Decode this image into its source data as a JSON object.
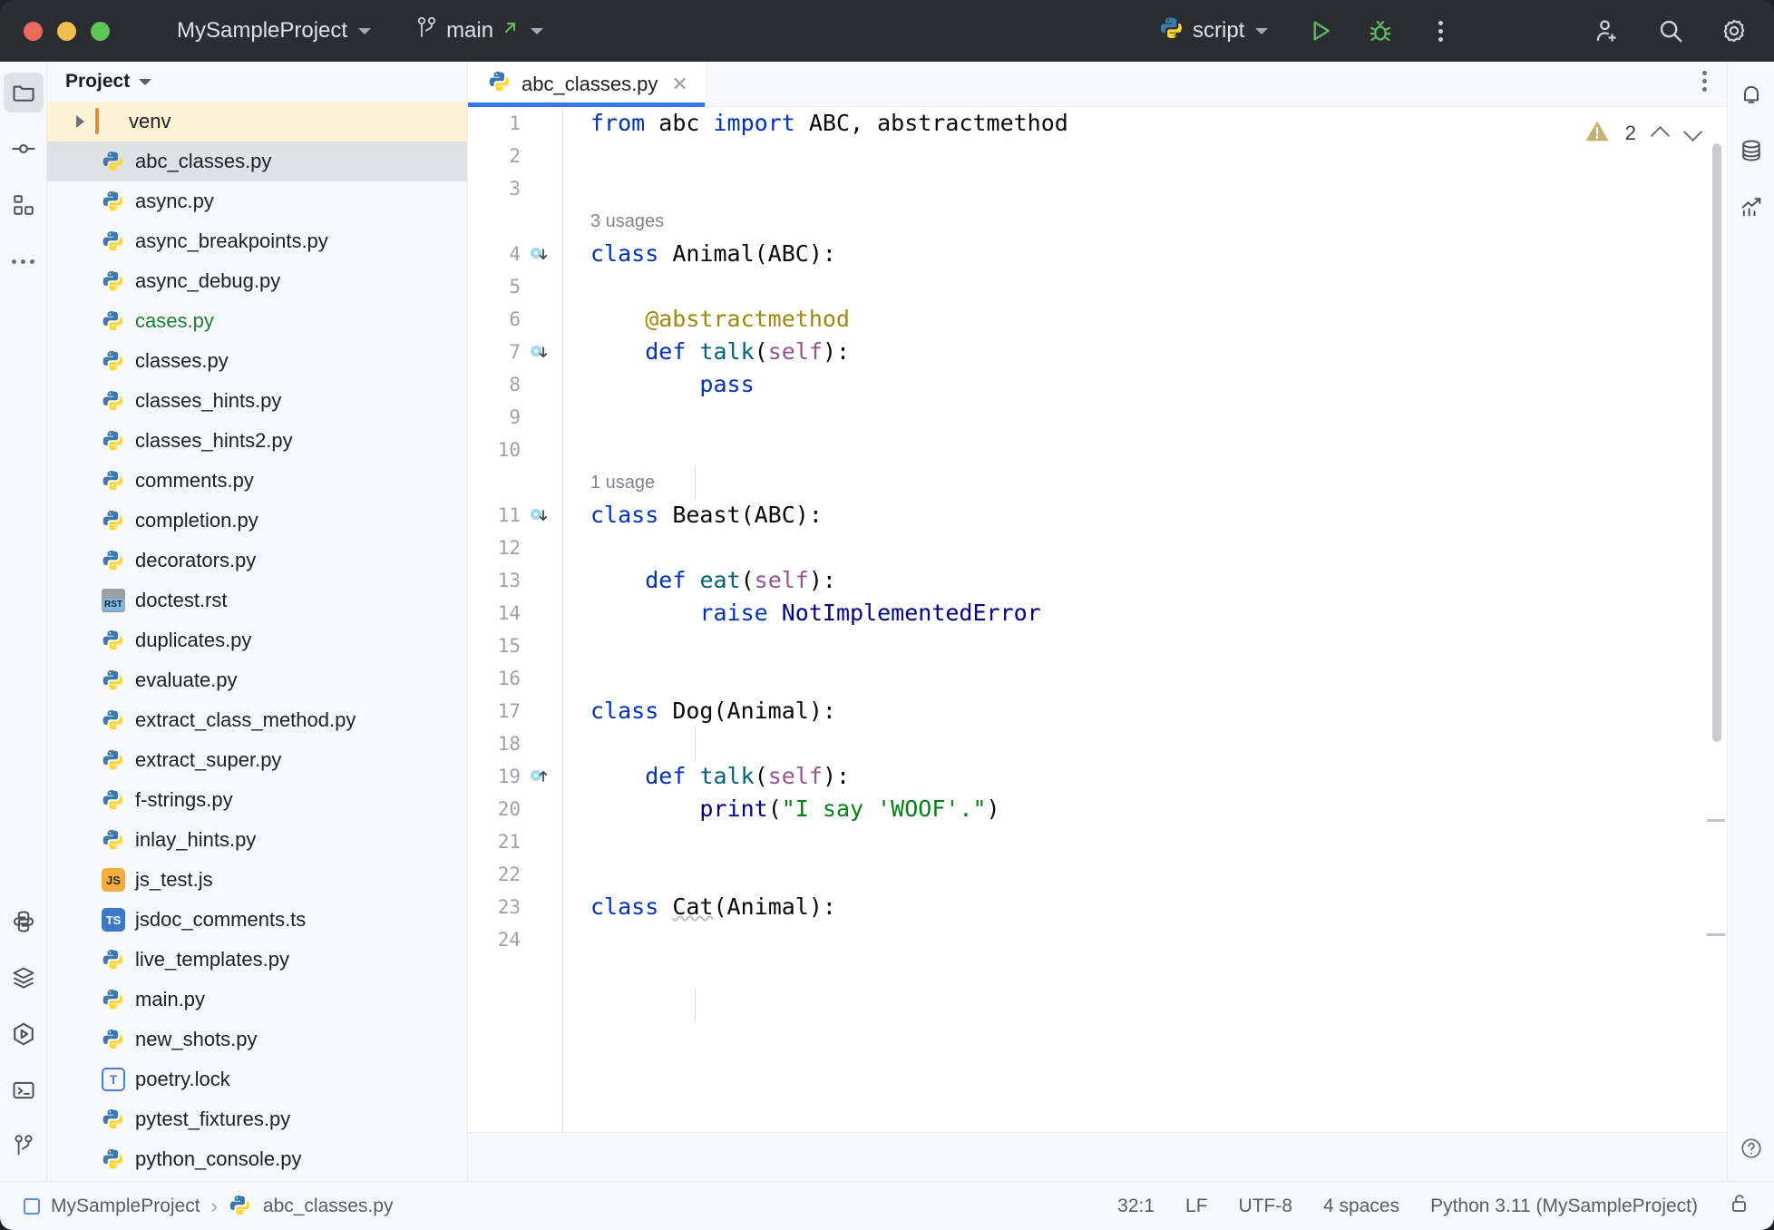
{
  "titlebar": {
    "project_name": "MySampleProject",
    "branch_name": "main",
    "run_config": "script",
    "icons": {
      "branch": "git-branch-icon",
      "branch_external": "external-link-icon",
      "python_config": "python-icon",
      "run": "run-icon",
      "debug": "debug-icon",
      "more": "more-options-icon",
      "share": "add-user-icon",
      "search": "search-icon",
      "settings": "gear-icon"
    }
  },
  "left_rail": {
    "items": [
      {
        "name": "project-tool-window",
        "icon": "folder-icon",
        "active": true
      },
      {
        "name": "commit-tool-window",
        "icon": "commit-icon",
        "active": false
      },
      {
        "name": "structure-tool-window",
        "icon": "structure-icon",
        "active": false
      },
      {
        "name": "more-tool-windows",
        "icon": "ellipsis-icon",
        "active": false
      }
    ],
    "bottom_items": [
      {
        "name": "python-console-tool-window",
        "icon": "python-console-icon"
      },
      {
        "name": "python-packages-tool-window",
        "icon": "layers-icon"
      },
      {
        "name": "run-tool-window",
        "icon": "run-hexagon-icon"
      },
      {
        "name": "terminal-tool-window",
        "icon": "terminal-icon"
      },
      {
        "name": "version-control-tool-window",
        "icon": "git-branch-icon"
      }
    ]
  },
  "project_panel": {
    "title": "Project",
    "files": [
      {
        "name": "venv",
        "type": "folder",
        "state": "highlighted",
        "expandable": true
      },
      {
        "name": "abc_classes.py",
        "type": "py",
        "state": "selected"
      },
      {
        "name": "async.py",
        "type": "py",
        "state": "normal"
      },
      {
        "name": "async_breakpoints.py",
        "type": "py",
        "state": "normal"
      },
      {
        "name": "async_debug.py",
        "type": "py",
        "state": "normal"
      },
      {
        "name": "cases.py",
        "type": "py",
        "state": "green"
      },
      {
        "name": "classes.py",
        "type": "py",
        "state": "normal"
      },
      {
        "name": "classes_hints.py",
        "type": "py",
        "state": "normal"
      },
      {
        "name": "classes_hints2.py",
        "type": "py",
        "state": "normal"
      },
      {
        "name": "comments.py",
        "type": "py",
        "state": "normal"
      },
      {
        "name": "completion.py",
        "type": "py",
        "state": "normal"
      },
      {
        "name": "decorators.py",
        "type": "py",
        "state": "normal"
      },
      {
        "name": "doctest.rst",
        "type": "rst",
        "state": "normal"
      },
      {
        "name": "duplicates.py",
        "type": "py",
        "state": "normal"
      },
      {
        "name": "evaluate.py",
        "type": "py",
        "state": "normal"
      },
      {
        "name": "extract_class_method.py",
        "type": "py",
        "state": "normal"
      },
      {
        "name": "extract_super.py",
        "type": "py",
        "state": "normal"
      },
      {
        "name": "f-strings.py",
        "type": "py",
        "state": "normal"
      },
      {
        "name": "inlay_hints.py",
        "type": "py",
        "state": "normal"
      },
      {
        "name": "js_test.js",
        "type": "js",
        "state": "normal"
      },
      {
        "name": "jsdoc_comments.ts",
        "type": "ts",
        "state": "normal"
      },
      {
        "name": "live_templates.py",
        "type": "py",
        "state": "normal"
      },
      {
        "name": "main.py",
        "type": "py",
        "state": "normal"
      },
      {
        "name": "new_shots.py",
        "type": "py",
        "state": "normal"
      },
      {
        "name": "poetry.lock",
        "type": "lock",
        "state": "normal"
      },
      {
        "name": "pytest_fixtures.py",
        "type": "py",
        "state": "normal"
      },
      {
        "name": "python_console.py",
        "type": "py",
        "state": "normal"
      }
    ]
  },
  "editor": {
    "tab_label": "abc_classes.py",
    "tab_icon": "python-icon",
    "close_label": "✕",
    "inspection": {
      "warning_count": "2",
      "icon": "warning-triangle-icon",
      "prev_icon": "chevron-up-icon",
      "next_icon": "chevron-down-icon"
    },
    "lines": [
      {
        "n": "1",
        "mark": "",
        "hint": "",
        "tokens": [
          {
            "t": "from",
            "c": "k"
          },
          {
            "t": " abc ",
            "c": ""
          },
          {
            "t": "import",
            "c": "k"
          },
          {
            "t": " ABC, abstractmethod",
            "c": ""
          }
        ]
      },
      {
        "n": "2",
        "mark": "",
        "hint": "",
        "tokens": []
      },
      {
        "n": "3",
        "mark": "",
        "hint": "",
        "tokens": []
      },
      {
        "n": "4",
        "mark": "impl-down",
        "hint": "3 usages",
        "tokens": [
          {
            "t": "class",
            "c": "k"
          },
          {
            "t": " Animal(ABC):",
            "c": ""
          }
        ]
      },
      {
        "n": "5",
        "mark": "",
        "hint": "",
        "tokens": []
      },
      {
        "n": "6",
        "mark": "",
        "hint": "",
        "tokens": [
          {
            "t": "    @abstractmethod",
            "c": "dec"
          }
        ]
      },
      {
        "n": "7",
        "mark": "impl-down",
        "hint": "",
        "tokens": [
          {
            "t": "    ",
            "c": ""
          },
          {
            "t": "def",
            "c": "k"
          },
          {
            "t": " ",
            "c": ""
          },
          {
            "t": "talk",
            "c": "fn"
          },
          {
            "t": "(",
            "c": ""
          },
          {
            "t": "self",
            "c": "slf"
          },
          {
            "t": "):",
            "c": ""
          }
        ]
      },
      {
        "n": "8",
        "mark": "",
        "hint": "",
        "tokens": [
          {
            "t": "        ",
            "c": ""
          },
          {
            "t": "pass",
            "c": "k"
          }
        ]
      },
      {
        "n": "9",
        "mark": "",
        "hint": "",
        "tokens": []
      },
      {
        "n": "10",
        "mark": "",
        "hint": "",
        "tokens": []
      },
      {
        "n": "11",
        "mark": "impl-down",
        "hint": "1 usage",
        "tokens": [
          {
            "t": "class",
            "c": "k"
          },
          {
            "t": " Beast(ABC):",
            "c": ""
          }
        ]
      },
      {
        "n": "12",
        "mark": "",
        "hint": "",
        "tokens": []
      },
      {
        "n": "13",
        "mark": "",
        "hint": "",
        "tokens": [
          {
            "t": "    ",
            "c": ""
          },
          {
            "t": "def",
            "c": "k"
          },
          {
            "t": " ",
            "c": ""
          },
          {
            "t": "eat",
            "c": "fn"
          },
          {
            "t": "(",
            "c": ""
          },
          {
            "t": "self",
            "c": "slf"
          },
          {
            "t": "):",
            "c": ""
          }
        ]
      },
      {
        "n": "14",
        "mark": "",
        "hint": "",
        "tokens": [
          {
            "t": "        ",
            "c": ""
          },
          {
            "t": "raise",
            "c": "k"
          },
          {
            "t": " ",
            "c": ""
          },
          {
            "t": "NotImplementedError",
            "c": "bi"
          }
        ]
      },
      {
        "n": "15",
        "mark": "",
        "hint": "",
        "tokens": []
      },
      {
        "n": "16",
        "mark": "",
        "hint": "",
        "tokens": []
      },
      {
        "n": "17",
        "mark": "",
        "hint": "",
        "tokens": [
          {
            "t": "class",
            "c": "k"
          },
          {
            "t": " Dog(Animal):",
            "c": ""
          }
        ]
      },
      {
        "n": "18",
        "mark": "",
        "hint": "",
        "tokens": []
      },
      {
        "n": "19",
        "mark": "impl-up",
        "hint": "",
        "tokens": [
          {
            "t": "    ",
            "c": ""
          },
          {
            "t": "def",
            "c": "k"
          },
          {
            "t": " ",
            "c": ""
          },
          {
            "t": "talk",
            "c": "fn"
          },
          {
            "t": "(",
            "c": ""
          },
          {
            "t": "self",
            "c": "slf"
          },
          {
            "t": "):",
            "c": ""
          }
        ]
      },
      {
        "n": "20",
        "mark": "",
        "hint": "",
        "tokens": [
          {
            "t": "        ",
            "c": ""
          },
          {
            "t": "print",
            "c": "bi"
          },
          {
            "t": "(",
            "c": ""
          },
          {
            "t": "\"I say 'WOOF'.\"",
            "c": "str"
          },
          {
            "t": ")",
            "c": ""
          }
        ]
      },
      {
        "n": "21",
        "mark": "",
        "hint": "",
        "tokens": []
      },
      {
        "n": "22",
        "mark": "",
        "hint": "",
        "tokens": []
      },
      {
        "n": "23",
        "mark": "",
        "hint": "",
        "tokens": [
          {
            "t": "class",
            "c": "k"
          },
          {
            "t": " ",
            "c": ""
          },
          {
            "t": "Cat",
            "c": "squig"
          },
          {
            "t": "(Animal):",
            "c": ""
          }
        ]
      },
      {
        "n": "24",
        "mark": "",
        "hint": "",
        "tokens": []
      }
    ]
  },
  "right_rail": {
    "items": [
      {
        "name": "notifications-tool-window",
        "icon": "bell-icon"
      },
      {
        "name": "database-tool-window",
        "icon": "database-icon"
      },
      {
        "name": "profiler-tool-window",
        "icon": "chart-icon"
      }
    ],
    "bottom": {
      "name": "problems-indicator",
      "icon": "help-icon"
    }
  },
  "statusbar": {
    "breadcrumb": [
      {
        "label": "MySampleProject",
        "icon": "project-square-icon"
      },
      {
        "label": "abc_classes.py",
        "icon": "python-icon"
      }
    ],
    "separator": "›",
    "caret_position": "32:1",
    "line_separator": "LF",
    "encoding": "UTF-8",
    "indent": "4 spaces",
    "interpreter": "Python 3.11 (MySampleProject)",
    "lock_icon": "lock-icon"
  },
  "colors": {
    "titlebar_bg": "#2b2d30",
    "panel_bg": "#f7f8fa",
    "editor_bg": "#ffffff",
    "accent_blue": "#3574f0",
    "keyword": "#0033b3",
    "string": "#067d17",
    "decorator": "#9e880d",
    "function": "#00627a",
    "self": "#94558d",
    "builtin": "#000080",
    "selection": "#dfe1e5",
    "highlight_row": "#fdf3d4",
    "green_file": "#1a7f37"
  }
}
